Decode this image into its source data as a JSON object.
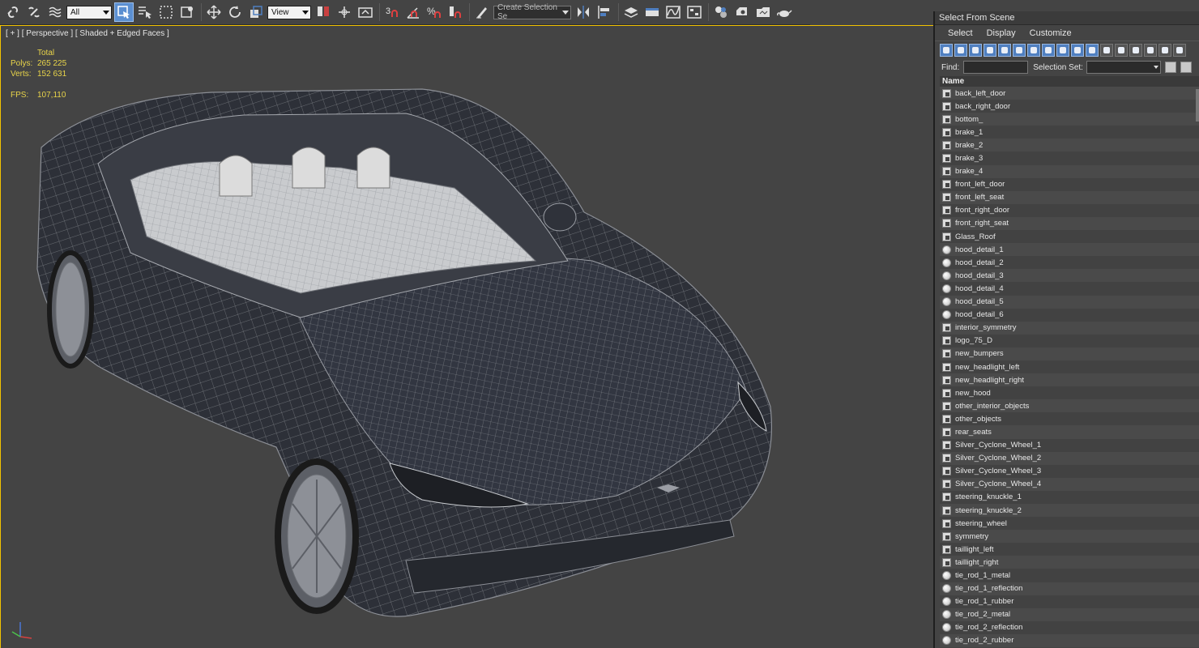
{
  "toolbar": {
    "filter_dropdown": "All",
    "coord_dropdown": "View",
    "snap_three": "3",
    "selection_set_dropdown": "Create Selection Se"
  },
  "viewport": {
    "label": "[ + ] [ Perspective ] [ Shaded + Edged Faces ]",
    "stats": {
      "total_label": "Total",
      "polys_label": "Polys:",
      "polys_value": "265 225",
      "verts_label": "Verts:",
      "verts_value": "152 631",
      "fps_label": "FPS:",
      "fps_value": "107,110"
    },
    "colors": {
      "border_active": "#f2c200",
      "stats_text": "#e8d44a",
      "background": "#444444"
    }
  },
  "panel": {
    "title": "Select From Scene",
    "menu": [
      "Select",
      "Display",
      "Customize"
    ],
    "find_label": "Find:",
    "selection_set_label": "Selection Set:",
    "column_header": "Name",
    "items": [
      {
        "name": "back_left_door",
        "icon": "group-icon"
      },
      {
        "name": "back_right_door",
        "icon": "group-icon"
      },
      {
        "name": "bottom_",
        "icon": "group-icon"
      },
      {
        "name": "brake_1",
        "icon": "group-icon"
      },
      {
        "name": "brake_2",
        "icon": "group-icon"
      },
      {
        "name": "brake_3",
        "icon": "group-icon"
      },
      {
        "name": "brake_4",
        "icon": "group-icon"
      },
      {
        "name": "front_left_door",
        "icon": "group-icon"
      },
      {
        "name": "front_left_seat",
        "icon": "group-icon"
      },
      {
        "name": "front_right_door",
        "icon": "group-icon"
      },
      {
        "name": "front_right_seat",
        "icon": "group-icon"
      },
      {
        "name": "Glass_Roof",
        "icon": "group-icon"
      },
      {
        "name": "hood_detail_1",
        "icon": "sphere-icon"
      },
      {
        "name": "hood_detail_2",
        "icon": "sphere-icon"
      },
      {
        "name": "hood_detail_3",
        "icon": "sphere-icon"
      },
      {
        "name": "hood_detail_4",
        "icon": "sphere-icon"
      },
      {
        "name": "hood_detail_5",
        "icon": "sphere-icon"
      },
      {
        "name": "hood_detail_6",
        "icon": "sphere-icon"
      },
      {
        "name": "interior_symmetry",
        "icon": "group-icon"
      },
      {
        "name": "logo_75_D",
        "icon": "group-icon"
      },
      {
        "name": "new_bumpers",
        "icon": "group-icon"
      },
      {
        "name": "new_headlight_left",
        "icon": "group-icon"
      },
      {
        "name": "new_headlight_right",
        "icon": "group-icon"
      },
      {
        "name": "new_hood",
        "icon": "group-icon"
      },
      {
        "name": "other_interior_objects",
        "icon": "group-icon"
      },
      {
        "name": "other_objects",
        "icon": "group-icon"
      },
      {
        "name": "rear_seats",
        "icon": "group-icon"
      },
      {
        "name": "Silver_Cyclone_Wheel_1",
        "icon": "group-icon"
      },
      {
        "name": "Silver_Cyclone_Wheel_2",
        "icon": "group-icon"
      },
      {
        "name": "Silver_Cyclone_Wheel_3",
        "icon": "group-icon"
      },
      {
        "name": "Silver_Cyclone_Wheel_4",
        "icon": "group-icon"
      },
      {
        "name": "steering_knuckle_1",
        "icon": "group-icon"
      },
      {
        "name": "steering_knuckle_2",
        "icon": "group-icon"
      },
      {
        "name": "steering_wheel",
        "icon": "group-icon"
      },
      {
        "name": "symmetry",
        "icon": "group-icon"
      },
      {
        "name": "taillight_left",
        "icon": "group-icon"
      },
      {
        "name": "taillight_right",
        "icon": "group-icon"
      },
      {
        "name": "tie_rod_1_metal",
        "icon": "sphere-icon"
      },
      {
        "name": "tie_rod_1_reflection",
        "icon": "sphere-icon"
      },
      {
        "name": "tie_rod_1_rubber",
        "icon": "sphere-icon"
      },
      {
        "name": "tie_rod_2_metal",
        "icon": "sphere-icon"
      },
      {
        "name": "tie_rod_2_reflection",
        "icon": "sphere-icon"
      },
      {
        "name": "tie_rod_2_rubber",
        "icon": "sphere-icon"
      }
    ]
  }
}
